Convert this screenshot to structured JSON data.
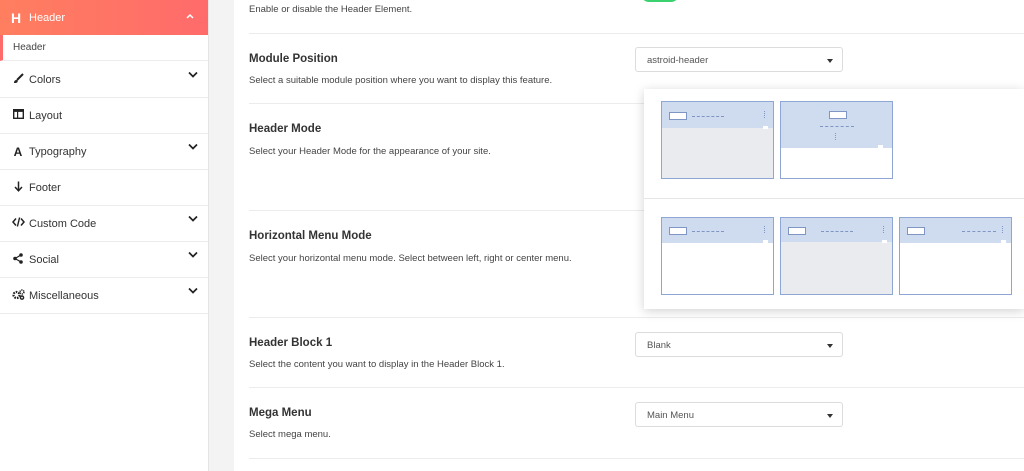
{
  "sidebar": {
    "active": {
      "label": "Header",
      "icon": "header-h-icon",
      "glyph": "H"
    },
    "sub_items": [
      {
        "label": "Header"
      }
    ],
    "items": [
      {
        "label": "Colors",
        "icon": "brush-icon",
        "has_children": true
      },
      {
        "label": "Layout",
        "icon": "layout-icon",
        "has_children": false
      },
      {
        "label": "Typography",
        "icon": "font-icon",
        "has_children": true
      },
      {
        "label": "Footer",
        "icon": "arrow-down-icon",
        "has_children": false
      },
      {
        "label": "Custom Code",
        "icon": "code-icon",
        "has_children": true
      },
      {
        "label": "Social",
        "icon": "share-icon",
        "has_children": true
      },
      {
        "label": "Miscellaneous",
        "icon": "cogs-icon",
        "has_children": true
      }
    ],
    "accent_color": "#ff6b6b"
  },
  "main": {
    "enable_row": {
      "description": "Enable or disable the Header Element.",
      "toggle_state": "on",
      "toggle_color": "#3bd16f"
    },
    "rows": [
      {
        "title": "Module Position",
        "description": "Select a suitable module position where you want to display this feature.",
        "control": "select",
        "value": "astroid-header"
      },
      {
        "title": "Header Mode",
        "description": "Select your Header Mode for the appearance of your site.",
        "control": "layout-picker"
      },
      {
        "title": "Horizontal Menu Mode",
        "description": "Select your horizontal menu mode. Select between left, right or center menu.",
        "control": "layout-picker"
      },
      {
        "title": "Header Block 1",
        "description": "Select the content you want to display in the Header Block 1.",
        "control": "select",
        "value": "Blank"
      },
      {
        "title": "Mega Menu",
        "description": "Select mega menu.",
        "control": "select",
        "value": "Main Menu"
      }
    ]
  },
  "mode_card": {
    "header_modes": [
      "horizontal",
      "stacked"
    ],
    "menu_modes": [
      "left",
      "center",
      "right"
    ]
  }
}
